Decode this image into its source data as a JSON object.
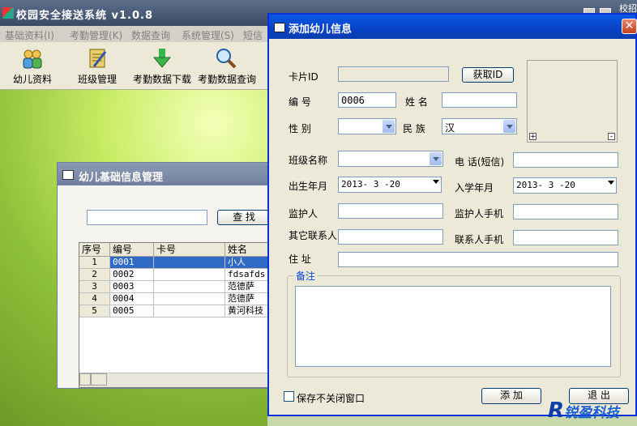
{
  "main_window": {
    "title": "校园安全接送系统 v1.0.8",
    "top_right_text": "校招",
    "menu": [
      "基础资料(I)",
      "考勤管理(K)",
      "数据查询",
      "系统管理(S)",
      "短信"
    ],
    "toolbar": [
      {
        "label": "幼儿资料",
        "icon": "children-icon"
      },
      {
        "label": "班级管理",
        "icon": "notebook-icon"
      },
      {
        "label": "考勤数据下载",
        "icon": "download-arrow-icon"
      },
      {
        "label": "考勤数据查询",
        "icon": "magnifier-icon"
      }
    ]
  },
  "child_window": {
    "title": "幼儿基础信息管理",
    "search_value": "",
    "search_button": "查 找",
    "columns": [
      "序号",
      "编号",
      "卡号",
      "姓名"
    ],
    "rows": [
      {
        "no": "1",
        "code": "0001",
        "card": "",
        "name": "小人",
        "selected": true
      },
      {
        "no": "2",
        "code": "0002",
        "card": "",
        "name": "fdsafds",
        "selected": false
      },
      {
        "no": "3",
        "code": "0003",
        "card": "",
        "name": "范德萨",
        "selected": false
      },
      {
        "no": "4",
        "code": "0004",
        "card": "",
        "name": "范德萨",
        "selected": false
      },
      {
        "no": "5",
        "code": "0005",
        "card": "",
        "name": "黄河科技",
        "selected": false
      }
    ]
  },
  "dialog": {
    "title": "添加幼儿信息",
    "close_glyph": "✕",
    "labels": {
      "card_id": "卡片ID",
      "code": "编  号",
      "name": "姓  名",
      "gender": "性  别",
      "ethnicity": "民  族",
      "class_name": "班级名称",
      "phone": "电  话(短信)",
      "birth": "出生年月",
      "enroll": "入学年月",
      "guardian": "监护人",
      "guardian_phone": "监护人手机",
      "other_contact": "其它联系人",
      "contact_phone": "联系人手机",
      "address": "住  址",
      "notes": "备注",
      "keep_open": "保存不关闭窗口"
    },
    "values": {
      "card_id": "",
      "code": "0006",
      "name": "",
      "gender": "",
      "ethnicity": "汉",
      "class_name": "",
      "phone": "",
      "birth": "2013- 3 -20",
      "enroll": "2013- 3 -20",
      "guardian": "",
      "guardian_phone": "",
      "other_contact": "",
      "contact_phone": "",
      "address": "",
      "notes": ""
    },
    "buttons": {
      "get_id": "获取ID",
      "add": "添  加",
      "exit": "退  出"
    },
    "photo_buttons": {
      "plus": "+",
      "minus": "-"
    }
  },
  "watermark": {
    "r": "R",
    "text": "锐盈科技"
  },
  "colors": {
    "dialog_title": "#0a5ae6",
    "selection": "#316ac5"
  }
}
